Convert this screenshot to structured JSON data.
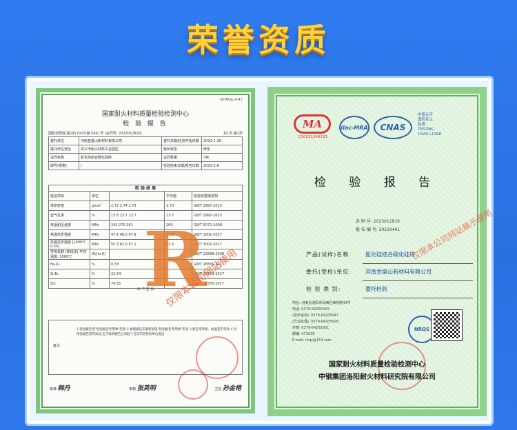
{
  "banner": {
    "title": "荣誉资质"
  },
  "left_cert": {
    "code": "NHTA/JL-4-47",
    "org": "国家耐火材料质量检验检测中心",
    "title": "检 验 报 告",
    "meta_left": "国耐材质检(委)字(2023)第 046) 号 (合同号: 2023012816)",
    "meta_right": "共1页 第1页",
    "rows": [
      {
        "k1": "委托单位",
        "v1": "河南金盛山新材料有限公司",
        "k2": "委托日期/检验开始日期",
        "v2": "2023-1-28"
      },
      {
        "k1": "委托单位地址",
        "v1": "巩义市耐火材料工业园区",
        "k2": "粉状状态",
        "v2": "砖形"
      },
      {
        "k1": "试样名称",
        "v1": "氮化硅结合碳化硅砖",
        "k2": "试样数量",
        "v2": "3块"
      },
      {
        "k1": "牌号(规格)",
        "v1": "/",
        "k2": "检验结束日期/报告日期",
        "v2": "2023-2-8"
      }
    ],
    "results_head": "检 验 结 果",
    "results": [
      {
        "name": "检验项目",
        "unit": "单位",
        "vals": "",
        "avg": "平均值",
        "std": "检验依据或说明"
      },
      {
        "name": "体积密度",
        "unit": "g/cm³",
        "vals": "2.72  2.74  2.73",
        "avg": "2.73",
        "std": "GB/T 2997-2015"
      },
      {
        "name": "显气孔率",
        "unit": "%",
        "vals": "13.8  13.7  13.7",
        "avg": "13.7",
        "std": "GB/T 2997-2015"
      },
      {
        "name": "常温耐压强度",
        "unit": "MPa",
        "vals": "242  270  261",
        "avg": "260",
        "std": "GB/T 5072-2008"
      },
      {
        "name": "常温抗折强度",
        "unit": "MPa",
        "vals": "47.6  48.0  47.9",
        "avg": "47.8",
        "std": "GB/T 3001-2017"
      },
      {
        "name": "高温抗折强度 [1400℃ 0.5h]",
        "unit": "MPa",
        "vals": "55.3  62.0  67.1",
        "avg": "61.5",
        "std": "GB/T 3002-2017"
      },
      {
        "name": "导热系数 (热线法) 平均温度: 1000℃",
        "unit": "W/(m·K)",
        "vals": "",
        "avg": "",
        "std": "GB/T 22588-2008"
      },
      {
        "name": "Fe₂O₃",
        "unit": "%",
        "vals": "0.33",
        "avg": "",
        "std": "GB/T 16555-2017"
      },
      {
        "name": "Si₃N₄",
        "unit": "%",
        "vals": "22.54",
        "avg": "",
        "std": "GB/T 16555-2017"
      },
      {
        "name": "SiC",
        "unit": "%",
        "vals": "74.55",
        "avg": "",
        "std": "GB/T 16555-2017"
      }
    ],
    "end_text": "以 下 空 白",
    "remarks_label": "备注",
    "remarks": "1.检验报告无\"检验报告专用章\"无效 2.复制报告未重新加盖\"检验报告专用章\"无效 3.报告无审核、批准签字无效 4.对检验报告若有异议,应于收到报告之日起十五日内向检验单位提出",
    "signer1_label": "批准",
    "signer1": "韩丹",
    "signer2_label": "审核",
    "signer2": "张英明",
    "signer3_label": "主检",
    "signer3": "孙金艳",
    "big_mark": "R",
    "watermark": "仅限本公司网站使用"
  },
  "right_cert": {
    "cma_text": "MA",
    "cma_number": "210021349133",
    "ilac": "ilac-MRA",
    "cnas": "CNAS",
    "cnas_lines": [
      "中国认可",
      "国际互认",
      "检测",
      "TESTING",
      "CNAS L1358"
    ],
    "title": "检 验 报 告",
    "contract_label": "合 同 号:",
    "contract_no": "2023012816",
    "report_label": "报 告 编 号:",
    "report_no": "20230461",
    "fields": [
      {
        "k": "产品(试样)名称:",
        "v": "氮化硅结合碳化硅砖"
      },
      {
        "k": "委托(受检)单位:",
        "v": "河南金盛山新材料有限公司"
      },
      {
        "k": "检 验 类 别:",
        "v": "委托检验"
      }
    ],
    "watermark": "仅限本公司网站展示使用",
    "contact": [
      "地址: 河南省洛阳市涧西区西苑路43号",
      "电话: 0379-64205933",
      "(技术咨询): 0379-64205947",
      "(异议处理): 0379-64205928",
      "传真: 0379-64205931",
      "邮编: 471039",
      "E-mail: nrqs@163.com"
    ],
    "nrqs": "NRQS",
    "org1": "国家耐火材料质量检验检测中心",
    "org2": "中钢集团洛阳耐火材料研究院有限公司"
  }
}
